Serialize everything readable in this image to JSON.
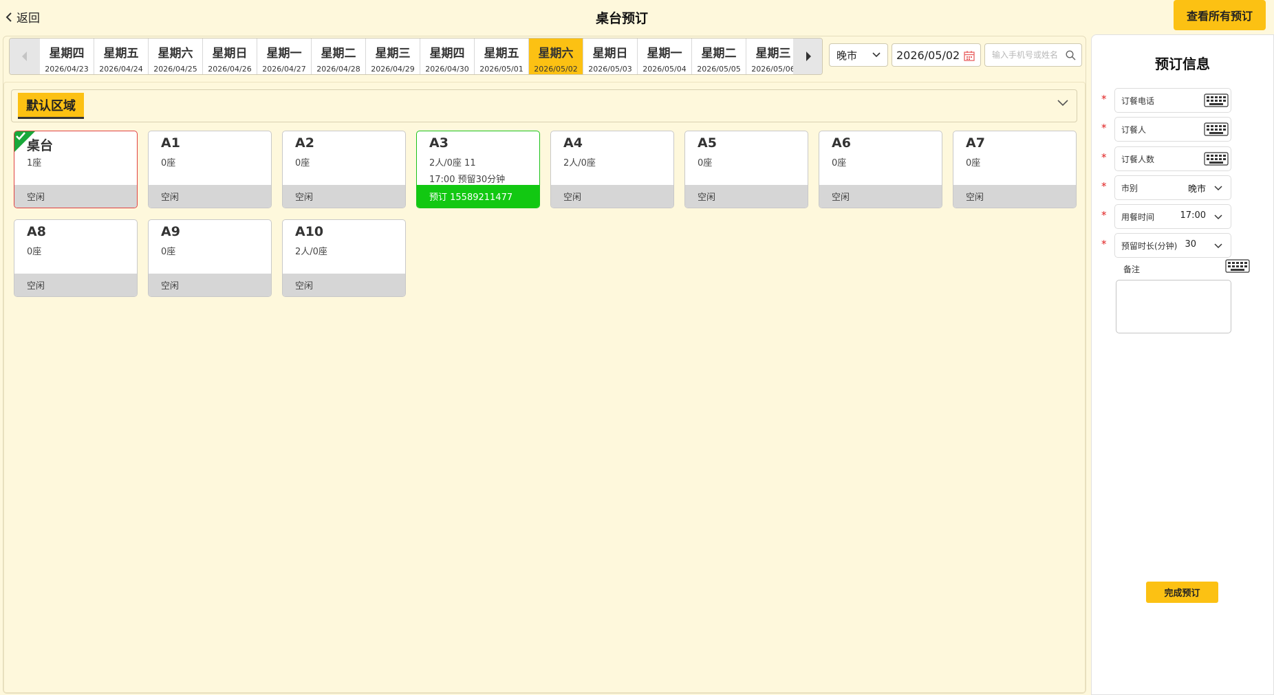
{
  "header": {
    "back_label": "返回",
    "title": "桌台预订",
    "view_all_label": "查看所有预订"
  },
  "date_strip": {
    "days": [
      {
        "weekday": "星期四",
        "date": "2026/04/23"
      },
      {
        "weekday": "星期五",
        "date": "2026/04/24"
      },
      {
        "weekday": "星期六",
        "date": "2026/04/25"
      },
      {
        "weekday": "星期日",
        "date": "2026/04/26"
      },
      {
        "weekday": "星期一",
        "date": "2026/04/27"
      },
      {
        "weekday": "星期二",
        "date": "2026/04/28"
      },
      {
        "weekday": "星期三",
        "date": "2026/04/29"
      },
      {
        "weekday": "星期四",
        "date": "2026/04/30"
      },
      {
        "weekday": "星期五",
        "date": "2026/05/01"
      },
      {
        "weekday": "星期六",
        "date": "2026/05/02"
      },
      {
        "weekday": "星期日",
        "date": "2026/05/03"
      },
      {
        "weekday": "星期一",
        "date": "2026/05/04"
      },
      {
        "weekday": "星期二",
        "date": "2026/05/05"
      },
      {
        "weekday": "星期三",
        "date": "2026/05/06"
      }
    ],
    "selected_index": 9
  },
  "filters": {
    "shift": "晚市",
    "date": "2026/05/02",
    "search_placeholder": "输入手机号或姓名"
  },
  "zone": {
    "name": "默认区域"
  },
  "tables": [
    {
      "name": "桌台",
      "seats": "1座",
      "note": "",
      "status": "空闲",
      "state": "selected"
    },
    {
      "name": "A1",
      "seats": "0座",
      "note": "",
      "status": "空闲",
      "state": "free"
    },
    {
      "name": "A2",
      "seats": "0座",
      "note": "",
      "status": "空闲",
      "state": "free"
    },
    {
      "name": "A3",
      "seats": "2人/0座    11",
      "note": "17:00    预留30分钟",
      "status": "预订    15589211477",
      "state": "reserved"
    },
    {
      "name": "A4",
      "seats": "2人/0座",
      "note": "",
      "status": "空闲",
      "state": "free"
    },
    {
      "name": "A5",
      "seats": "0座",
      "note": "",
      "status": "空闲",
      "state": "free"
    },
    {
      "name": "A6",
      "seats": "0座",
      "note": "",
      "status": "空闲",
      "state": "free"
    },
    {
      "name": "A7",
      "seats": "0座",
      "note": "",
      "status": "空闲",
      "state": "free"
    },
    {
      "name": "A8",
      "seats": "0座",
      "note": "",
      "status": "空闲",
      "state": "free"
    },
    {
      "name": "A9",
      "seats": "0座",
      "note": "",
      "status": "空闲",
      "state": "free"
    },
    {
      "name": "A10",
      "seats": "2人/0座",
      "note": "",
      "status": "空闲",
      "state": "free"
    }
  ],
  "booking_form": {
    "title": "预订信息",
    "phone_label": "订餐电话",
    "name_label": "订餐人",
    "people_label": "订餐人数",
    "shift_label": "市别",
    "shift_value": "晚市",
    "time_label": "用餐时间",
    "time_value": "17:00",
    "hold_label": "预留时长(分钟)",
    "hold_value": "30",
    "note_label": "备注",
    "submit_label": "完成预订"
  },
  "colors": {
    "background": "#fef8dc",
    "accent": "#fcc113",
    "reserved": "#12c812",
    "selected_border": "#e04040",
    "required": "#e02020"
  }
}
